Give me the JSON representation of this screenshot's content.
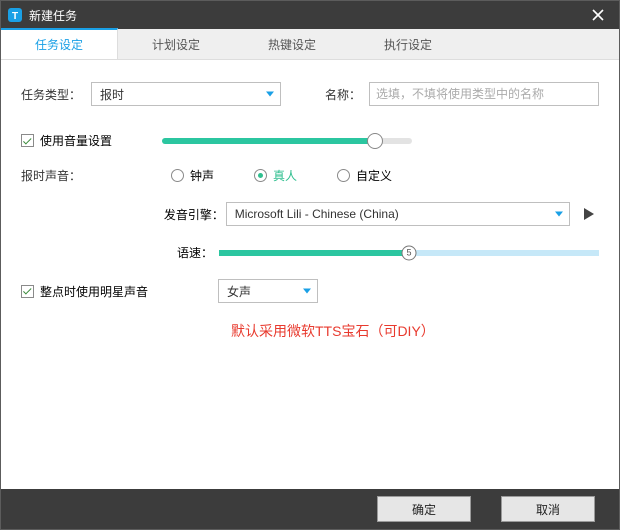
{
  "window": {
    "title": "新建任务"
  },
  "tabs": {
    "task": "任务设定",
    "schedule": "计划设定",
    "hotkey": "热键设定",
    "execute": "执行设定"
  },
  "task_type": {
    "label": "任务类型：",
    "value": "报时"
  },
  "name": {
    "label": "名称：",
    "placeholder": "选填，不填将使用类型中的名称"
  },
  "volume": {
    "checkbox_label": "使用音量设置",
    "percent": 85
  },
  "sound": {
    "label": "报时声音：",
    "options": {
      "bell": "钟声",
      "human": "真人",
      "custom": "自定义"
    },
    "selected": "human"
  },
  "engine": {
    "label": "发音引擎：",
    "value": "Microsoft Lili - Chinese (China)"
  },
  "speed": {
    "label": "语速：",
    "thumb_label": "5",
    "percent": 50
  },
  "star_voice": {
    "checkbox_label": "整点时使用明星声音",
    "value": "女声"
  },
  "note": "默认采用微软TTS宝石（可DIY）",
  "footer": {
    "ok": "确定",
    "cancel": "取消"
  },
  "chart_data": {
    "type": "table",
    "volume_slider": {
      "min": 0,
      "max": 100,
      "value": 85
    },
    "speed_slider": {
      "min": 0,
      "max": 10,
      "value": 5
    }
  }
}
